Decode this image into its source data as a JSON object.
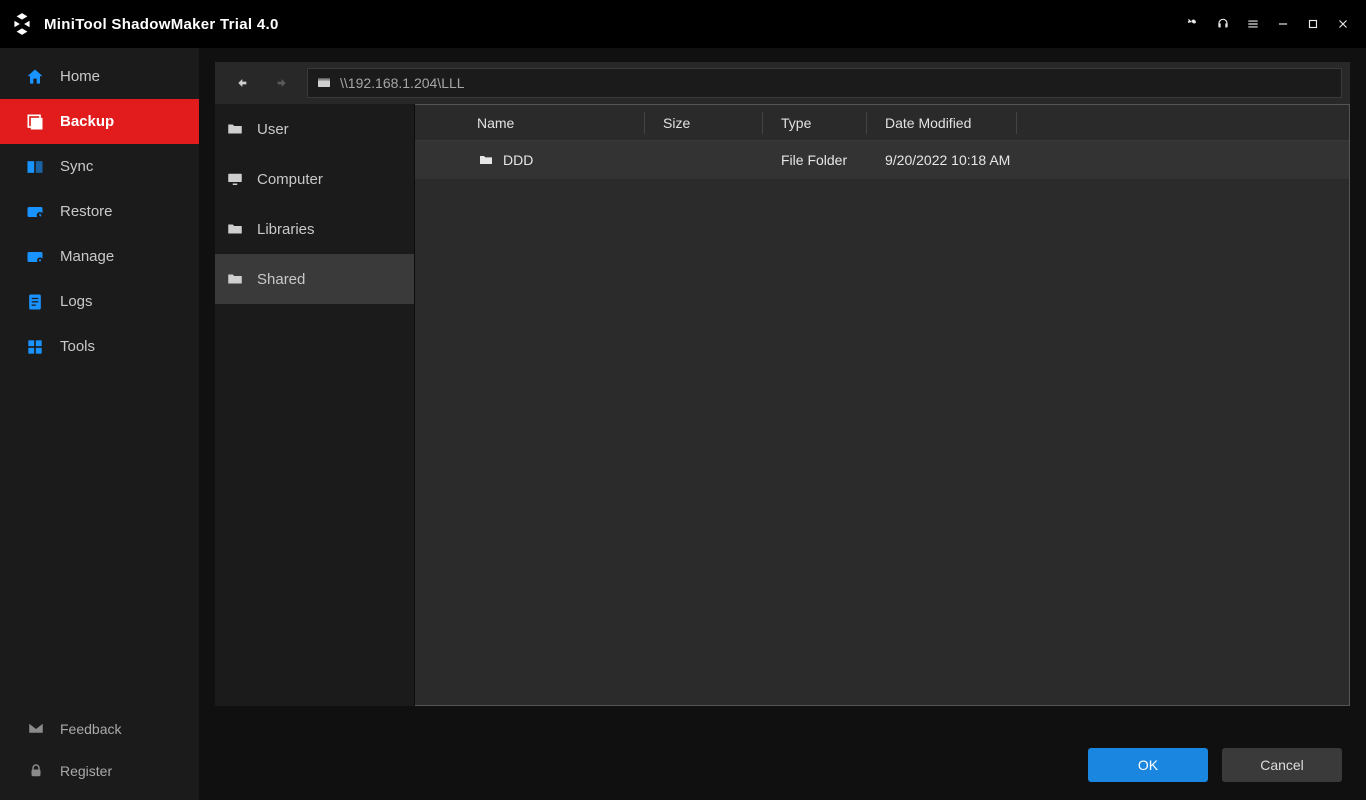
{
  "app": {
    "title": "MiniTool ShadowMaker Trial 4.0"
  },
  "sidebar": {
    "items": [
      {
        "label": "Home"
      },
      {
        "label": "Backup"
      },
      {
        "label": "Sync"
      },
      {
        "label": "Restore"
      },
      {
        "label": "Manage"
      },
      {
        "label": "Logs"
      },
      {
        "label": "Tools"
      }
    ],
    "bottom": [
      {
        "label": "Feedback"
      },
      {
        "label": "Register"
      }
    ]
  },
  "path": {
    "value": "\\\\192.168.1.204\\LLL"
  },
  "locations": [
    {
      "label": "User"
    },
    {
      "label": "Computer"
    },
    {
      "label": "Libraries"
    },
    {
      "label": "Shared"
    }
  ],
  "columns": {
    "name": "Name",
    "size": "Size",
    "type": "Type",
    "date": "Date Modified"
  },
  "rows": [
    {
      "name": "DDD",
      "size": "",
      "type": "File Folder",
      "date": "9/20/2022 10:18 AM"
    }
  ],
  "buttons": {
    "ok": "OK",
    "cancel": "Cancel"
  }
}
